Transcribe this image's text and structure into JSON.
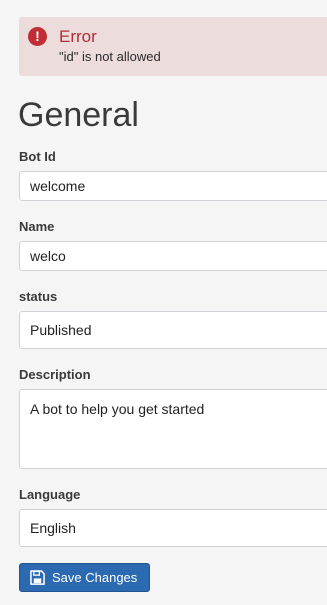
{
  "alert": {
    "title": "Error",
    "message": "\"id\" is not allowed",
    "icon": "exclamation-icon",
    "color": "#c02d37"
  },
  "page_title": "General",
  "fields": {
    "bot_id": {
      "label": "Bot Id",
      "value": "welcome"
    },
    "name": {
      "label": "Name",
      "value": "welco"
    },
    "status": {
      "label": "status",
      "value": "Published"
    },
    "description": {
      "label": "Description",
      "value": "A bot to help you get started"
    },
    "language": {
      "label": "Language",
      "value": "English"
    }
  },
  "save_button": {
    "label": "Save Changes",
    "icon": "floppy-disk-icon",
    "color": "#2b6ab1"
  }
}
